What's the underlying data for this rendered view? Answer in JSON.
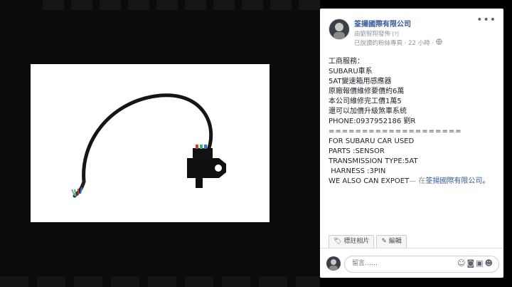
{
  "post": {
    "page_name": "筌揚國際有限公司",
    "posted_by": "由劉智翔發佈",
    "posted_by_tag": "[?]",
    "audience_line": "已說讚的粉絲專頁 · 22 小時 ·",
    "text_lines": [
      "工商服務：",
      "SUBARU車系",
      "5AT變速箱用感應器",
      "原廠報價維修要價約6萬",
      "本公司維修完工價1萬5",
      "還可以加價升級煞車系統",
      "PHONE:0937952186 劉R",
      "====================",
      "FOR SUBARU CAR USED",
      "PARTS :SENSOR",
      "TRANSMISSION TYPE:5AT",
      " HARNESS :3PIN",
      "WE ALSO CAN EXPOET"
    ],
    "location_prefix": "— 在",
    "location_link": "筌揚國際有限公司",
    "location_suffix": "。"
  },
  "actions": {
    "tag_photo": "標註相片",
    "edit": "編輯"
  },
  "comment": {
    "placeholder": "留言……"
  },
  "icons": [
    "more-options-icon",
    "globe-icon",
    "tag-icon",
    "pencil-icon",
    "emoji-icon",
    "camera-icon",
    "gif-icon",
    "sticker-icon"
  ]
}
